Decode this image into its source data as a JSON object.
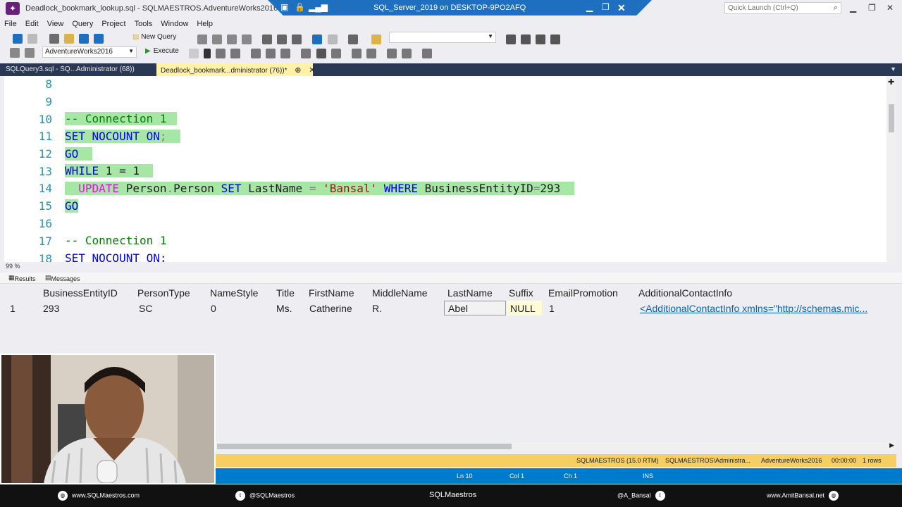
{
  "window": {
    "title": "Deadlock_bookmark_lookup.sql - SQLMAESTROS.AdventureWorks2016 (S",
    "remote_title": "SQL_Server_2019 on DESKTOP-9PO2AFQ",
    "quick_launch_placeholder": "Quick Launch (Ctrl+Q)"
  },
  "menu": [
    "File",
    "Edit",
    "View",
    "Query",
    "Project",
    "Tools",
    "Window",
    "Help"
  ],
  "toolbar": {
    "new_query_label": "New Query",
    "database": "AdventureWorks2016",
    "execute_label": "Execute"
  },
  "tabs": [
    {
      "label": "SQLQuery3.sql - SQ...Administrator (68))",
      "active": false
    },
    {
      "label": "Deadlock_bookmark...dministrator (76))*",
      "active": true
    }
  ],
  "editor": {
    "lines": [
      {
        "num": "8"
      },
      {
        "num": "9"
      },
      {
        "num": "10"
      },
      {
        "num": "11"
      },
      {
        "num": "12"
      },
      {
        "num": "13"
      },
      {
        "num": "14"
      },
      {
        "num": "15"
      },
      {
        "num": "16"
      },
      {
        "num": "17"
      },
      {
        "num": "18"
      }
    ],
    "code": {
      "l10": "-- Connection 1",
      "l11a": "SET NOCOUNT ON",
      "l11b": ";",
      "l12": "GO",
      "l13a": "WHILE",
      "l13b": " 1 = 1",
      "l14a": "UPDATE",
      "l14b": " Person",
      "l14c": ".",
      "l14d": "Person ",
      "l14e": "SET",
      "l14f": " LastName ",
      "l14g": "=",
      "l14h": "'Bansal'",
      "l14i": "WHERE",
      "l14j": " BusinessEntityID",
      "l14k": "=",
      "l14l": "293",
      "l15": "GO",
      "l17": "-- Connection 1",
      "l18": "SET NOCOUNT ON;"
    },
    "zoom": "99 %"
  },
  "results": {
    "tabs": [
      "Results",
      "Messages"
    ],
    "columns": [
      "BusinessEntityID",
      "PersonType",
      "NameStyle",
      "Title",
      "FirstName",
      "MiddleName",
      "LastName",
      "Suffix",
      "EmailPromotion",
      "AdditionalContactInfo"
    ],
    "row": {
      "rownum": "1",
      "cells": [
        "293",
        "SC",
        "0",
        "Ms.",
        "Catherine",
        "R.",
        "Abel",
        "NULL",
        "1",
        "<AdditionalContactInfo xmlns=\"http://schemas.mic..."
      ]
    }
  },
  "query_status": {
    "server": "SQLMAESTROS (15.0 RTM)",
    "user": "SQLMAESTROS\\Administra...",
    "database": "AdventureWorks2016",
    "time": "00:00:00",
    "rows": "1 rows"
  },
  "status_bar": {
    "ln": "Ln 10",
    "col": "Col 1",
    "ch": "Ch 1",
    "mode": "INS"
  },
  "footer": {
    "website": "www.SQLMaestros.com",
    "twitter1": "@SQLMaestros",
    "brand": "SQLMaestros",
    "twitter2": "@A_Bansal",
    "website2": "www.AmitBansal.net"
  },
  "colors": {
    "highlight": "#a6e7a6",
    "active_tab": "#fff1a8",
    "status_blue": "#007acc",
    "query_status_yellow": "#f6ce62"
  }
}
